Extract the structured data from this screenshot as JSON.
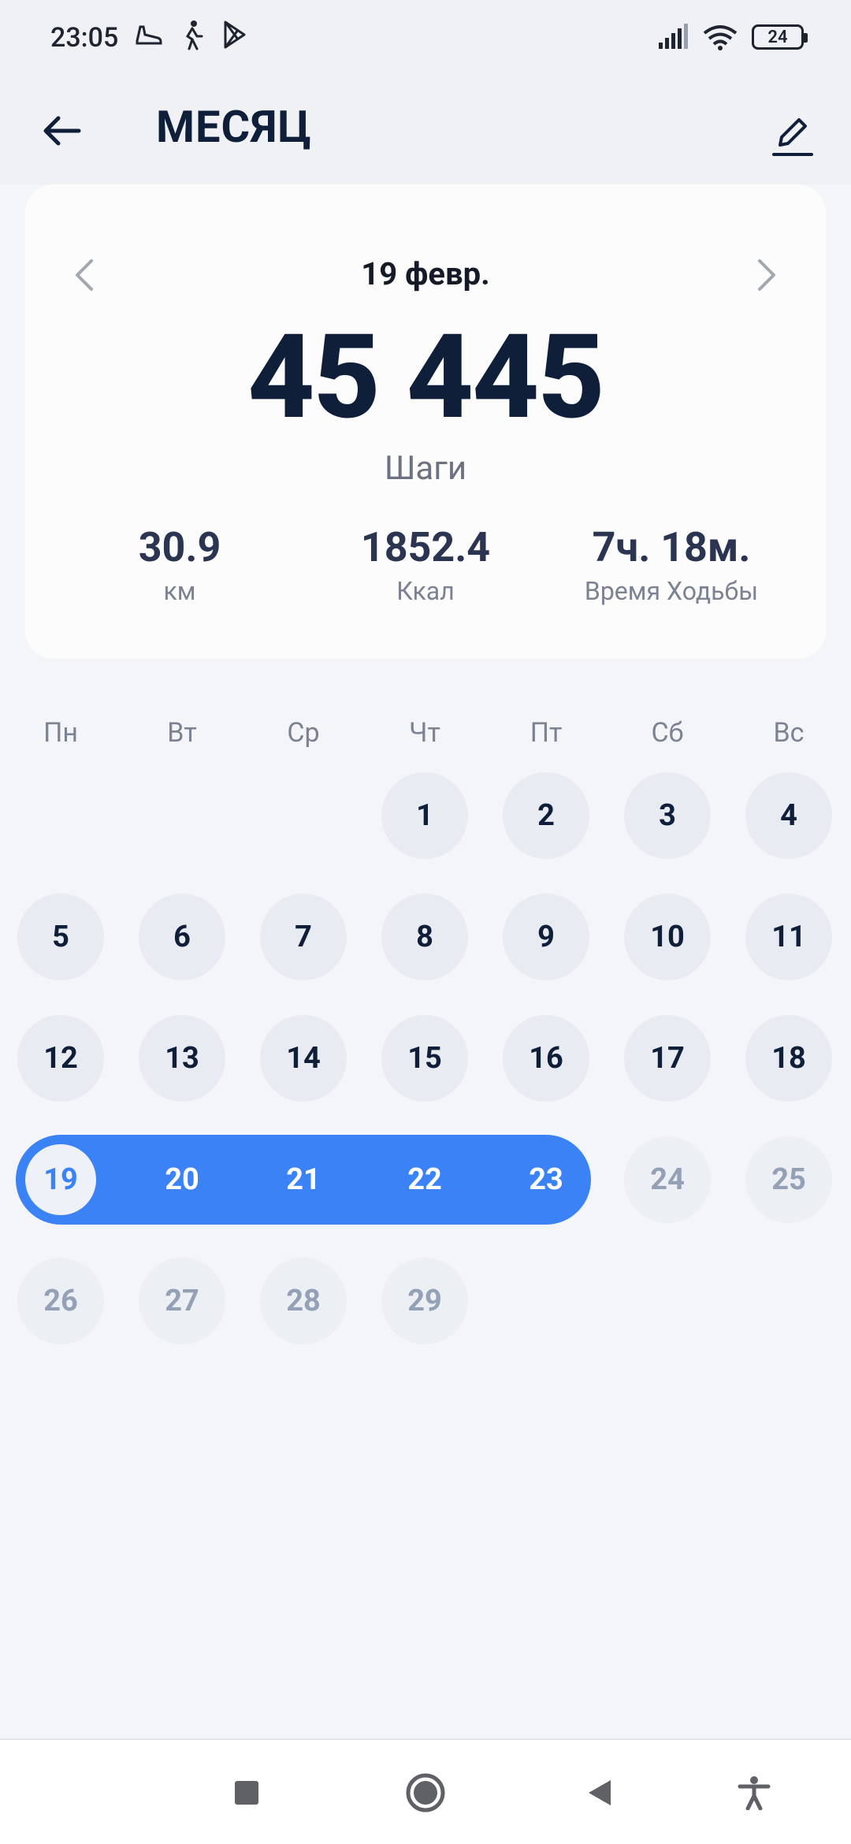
{
  "status_bar": {
    "time": "23:05",
    "battery": "24",
    "left_icons": [
      "shoe-icon",
      "walking-icon",
      "play-store-icon"
    ],
    "right_icons": [
      "signal-icon",
      "wifi-icon",
      "battery-icon"
    ]
  },
  "app_bar": {
    "title": "МЕСЯЦ",
    "back_icon": "arrow-left-icon",
    "edit_icon": "pencil-icon"
  },
  "summary": {
    "date": "19 февр.",
    "steps": "45 445",
    "steps_label": "Шаги",
    "stats": [
      {
        "value": "30.9",
        "label": "км"
      },
      {
        "value": "1852.4",
        "label": "Ккал"
      },
      {
        "value": "7ч. 18м.",
        "label": "Время Ходьбы"
      }
    ]
  },
  "calendar": {
    "weekdays": [
      "Пн",
      "Вт",
      "Ср",
      "Чт",
      "Пт",
      "Сб",
      "Вс"
    ],
    "days": [
      "1",
      "2",
      "3",
      "4",
      "5",
      "6",
      "7",
      "8",
      "9",
      "10",
      "11",
      "12",
      "13",
      "14",
      "15",
      "16",
      "17",
      "18",
      "19",
      "20",
      "21",
      "22",
      "23",
      "24",
      "25",
      "26",
      "27",
      "28",
      "29"
    ],
    "selected_day": "19",
    "range_end": "23",
    "accent_color": "#3b82f6"
  },
  "nav_bar": {
    "icons": [
      "recents-icon",
      "home-icon",
      "back-icon",
      "accessibility-icon"
    ]
  }
}
